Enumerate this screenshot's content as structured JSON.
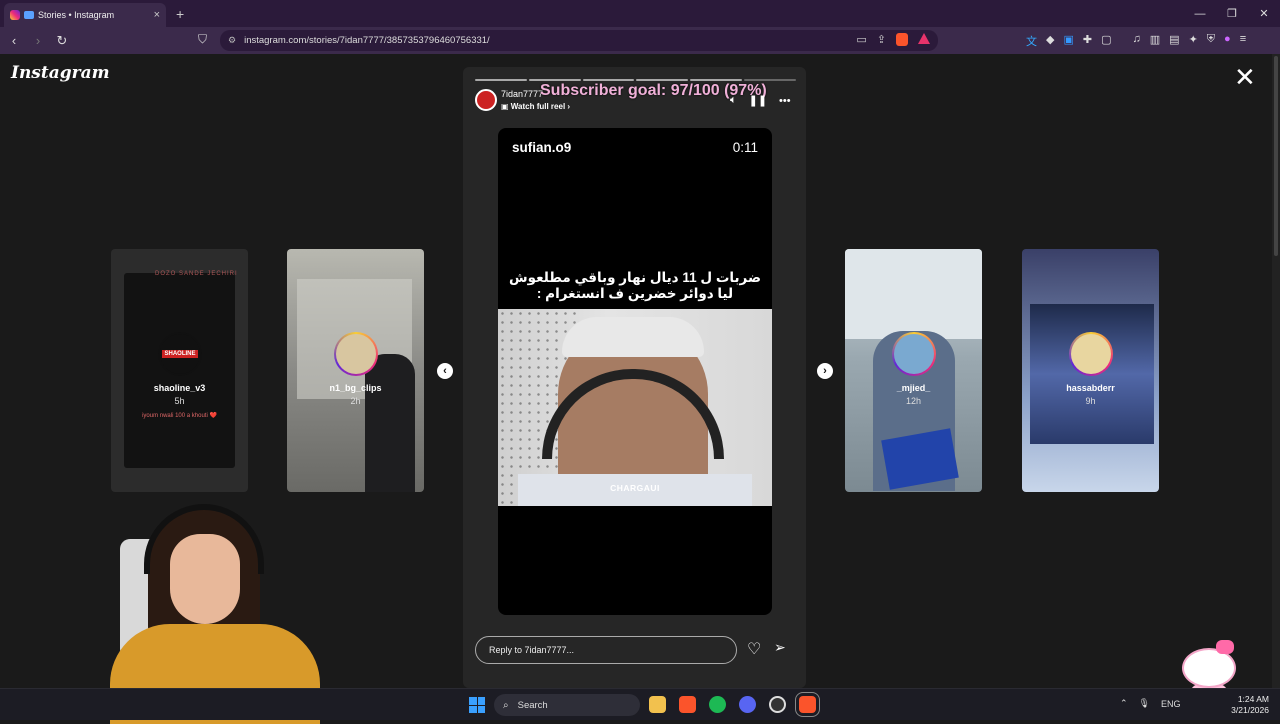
{
  "browser": {
    "tab_title": "Stories • Instagram",
    "tab_close": "×",
    "new_tab": "+",
    "url": "instagram.com/stories/7idan7777/3857353796460756331/",
    "win_min": "—",
    "win_max": "❐",
    "win_close": "✕"
  },
  "page": {
    "logo": "Instagram",
    "close": "✕"
  },
  "previews": [
    {
      "name": "shaoline_v3",
      "time": "5h",
      "tag": "DOZO SANDE JECHIRI",
      "caption": "iyoum nwali 100 a khouti ❤️",
      "avatar_text": "SHAOLINE"
    },
    {
      "name": "n1_bg_clips",
      "time": "2h"
    },
    {
      "name": "_mjied_",
      "time": "12h"
    },
    {
      "name": "hassabderr",
      "time": "9h"
    }
  ],
  "story": {
    "user": "7idan7777",
    "watch_full": "Watch full reel ›",
    "overlay_goal": "Subscriber goal: 97/100 (97%)",
    "video_user": "sufian.o9",
    "video_time": "0:11",
    "caption_line1": "ضربات ل 11 ديال نهار وباقي مطلعوش",
    "caption_line2": "ليا دوائر خضرين ف انستغرام :",
    "watermark": "CHARGAUI",
    "reply_placeholder": "Reply to 7idan7777...",
    "segments": 6
  },
  "taskbar": {
    "search": "Search",
    "lang": "ENG",
    "time": "1:24 AM",
    "date": "3/21/2026"
  },
  "colors": {
    "browser_frame": "#3b2a4b",
    "overlay_text": "#f0b0d8",
    "ig_gradient_start": "#f9ce34",
    "ig_gradient_end": "#6228d7"
  }
}
